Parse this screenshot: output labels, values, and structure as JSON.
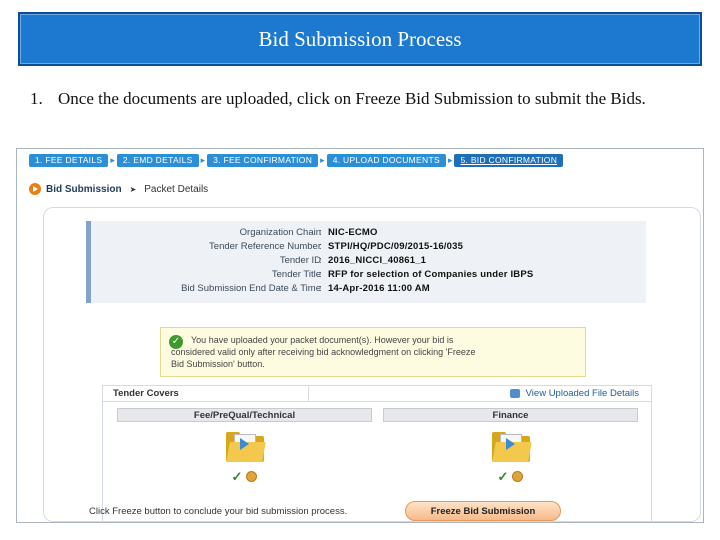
{
  "slide": {
    "title": "Bid Submission Process",
    "step_number": "1.",
    "step_text": "Once the documents are uploaded, click on Freeze Bid Submission to submit the Bids."
  },
  "wizard": {
    "steps": [
      "1. FEE DETAILS",
      "2. EMD DETAILS",
      "3. FEE CONFIRMATION",
      "4. UPLOAD DOCUMENTS",
      "5. BID CONFIRMATION"
    ],
    "active_step": 5,
    "accent_color": "#2a8fd6"
  },
  "breadcrumb": {
    "root": "Bid Submission",
    "current": "Packet Details"
  },
  "tender_info": {
    "rows": [
      {
        "label": "Organization Chain",
        "value": "NIC-ECMO"
      },
      {
        "label": "Tender Reference Number",
        "value": "STPI/HQ/PDC/09/2015-16/035"
      },
      {
        "label": "Tender ID",
        "value": "2016_NICCI_40861_1"
      },
      {
        "label": "Tender Title",
        "value": "RFP for selection of Companies under IBPS"
      },
      {
        "label": "Bid Submission End Date & Time",
        "value": "14-Apr-2016 11:00 AM"
      }
    ]
  },
  "notice": {
    "line1": "You have uploaded your packet document(s). However your bid is",
    "line2": "considered valid only after receiving bid acknowledgment on clicking 'Freeze",
    "line3": "Bid Submission' button."
  },
  "covers": {
    "header": "Tender Covers",
    "view_link": "View Uploaded File Details",
    "columns": [
      "Fee/PreQual/Technical",
      "Finance"
    ]
  },
  "footer": {
    "text": "Click Freeze button to conclude your bid submission process.",
    "freeze_button": "Freeze Bid Submission"
  }
}
